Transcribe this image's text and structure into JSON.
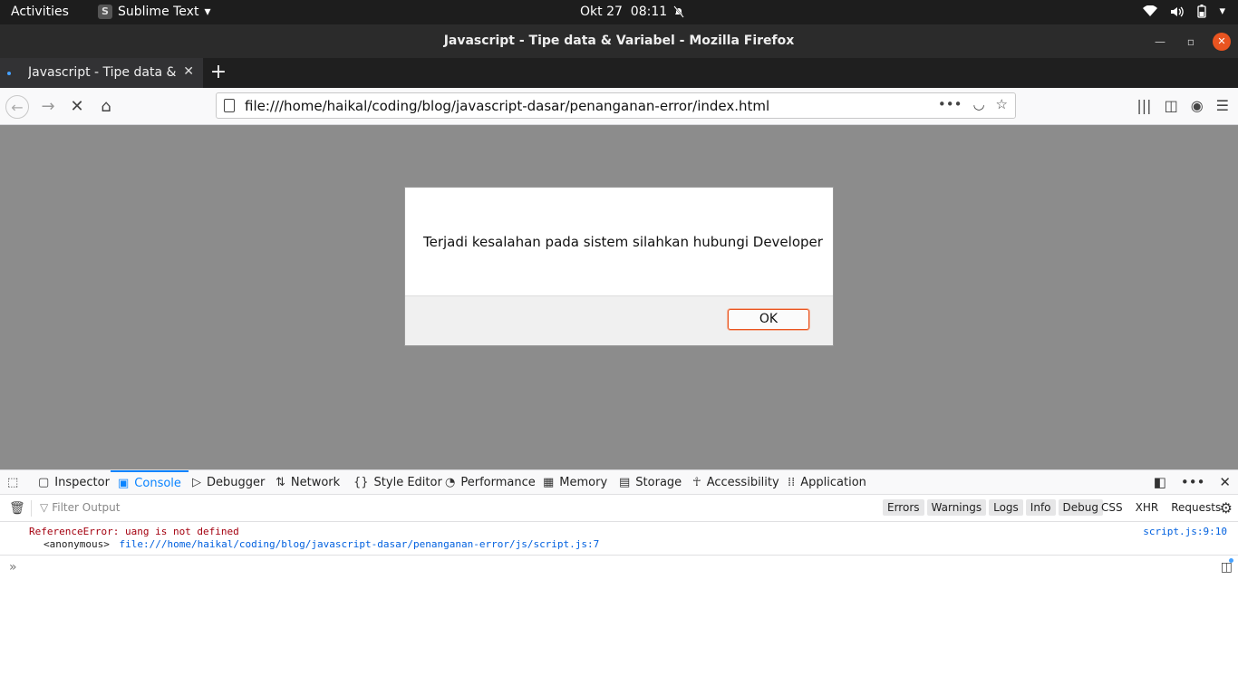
{
  "topbar": {
    "activities": "Activities",
    "app_name": "Sublime Text",
    "app_menu_icon": "caret-down-icon",
    "clock": "Okt 27  08:11",
    "notification_icon": "bell-muted-icon",
    "sys_icons": [
      "wifi-icon",
      "volume-icon",
      "battery-icon",
      "caret-down-icon"
    ]
  },
  "window": {
    "title": "Javascript - Tipe data & Variabel - Mozilla Firefox"
  },
  "tabs": [
    {
      "title": "Javascript - Tipe data & Variabel",
      "active": true
    }
  ],
  "navbar": {
    "url": "file:///home/haikal/coding/blog/javascript-dasar/penanganan-error/index.html"
  },
  "dialog": {
    "message": "Terjadi kesalahan pada sistem silahkan hubungi Developer",
    "ok_label": "OK"
  },
  "devtools": {
    "tabs": [
      {
        "label": "Inspector",
        "icon": "inspector-icon"
      },
      {
        "label": "Console",
        "icon": "console-icon",
        "selected": true
      },
      {
        "label": "Debugger",
        "icon": "debugger-icon"
      },
      {
        "label": "Network",
        "icon": "network-icon"
      },
      {
        "label": "Style Editor",
        "icon": "style-editor-icon"
      },
      {
        "label": "Performance",
        "icon": "performance-icon"
      },
      {
        "label": "Memory",
        "icon": "memory-icon"
      },
      {
        "label": "Storage",
        "icon": "storage-icon"
      },
      {
        "label": "Accessibility",
        "icon": "accessibility-icon"
      },
      {
        "label": "Application",
        "icon": "application-icon"
      }
    ],
    "filter_placeholder": "Filter Output",
    "levels": [
      "Errors",
      "Warnings",
      "Logs",
      "Info",
      "Debug"
    ],
    "others": [
      "CSS",
      "XHR",
      "Requests"
    ],
    "log": {
      "error": "ReferenceError: uang is not defined",
      "stack_fn": "<anonymous>",
      "stack_link": "file:///home/haikal/coding/blog/javascript-dasar/penanganan-error/js/script.js:7",
      "source": "script.js:9:10"
    }
  },
  "colors": {
    "accent": "#0a84ff",
    "error": "#a4000f",
    "ubuntu_orange": "#e95420"
  }
}
